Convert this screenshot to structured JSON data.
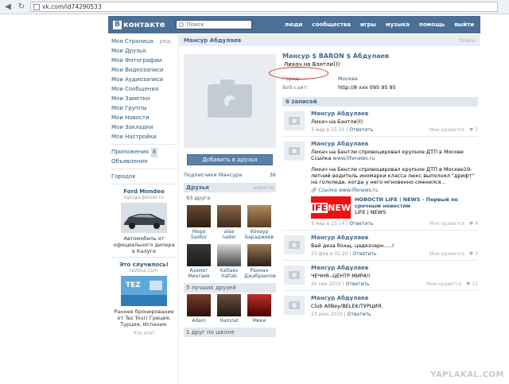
{
  "browser": {
    "url": "vk.com/id74290533"
  },
  "header": {
    "logo_text": "контакте",
    "logo_letter": "В",
    "search_placeholder": "Поиск",
    "nav": [
      "люди",
      "сообщества",
      "игры",
      "музыка",
      "помощь",
      "выйти"
    ]
  },
  "sidebar": {
    "items": [
      "Моя Страница",
      "Мои Друзья",
      "Мои Фотографии",
      "Мои Видеозаписи",
      "Мои Аудиозаписи",
      "Мои Сообщения",
      "Мои Заметки",
      "Мои Группы",
      "Мои Новости",
      "Мои Закладки",
      "Мои Настройки"
    ],
    "edit_label": "ред.",
    "apps_label": "Приложения",
    "apps_badge": "8",
    "ads_label": "Объявления",
    "city_label": "Городок",
    "ad1": {
      "title": "Ford Mondeo",
      "site": "kaluga.genser.ru",
      "text": "Автомобиль от официального дилера в Калуге"
    },
    "ad2": {
      "title": "Это случилось!",
      "site": "teztour.com",
      "text": "Раннее бронирование от Tez Tour! Греция, Турция, Испания."
    },
    "ad_link": "Что это?"
  },
  "profile": {
    "bar_name": "Мансур Абдулаев",
    "online": "Online",
    "full_name": "Мансур $ BARON $ Абдулаев",
    "status": "Лихач на Бэнтли)))",
    "city_key": "Город:",
    "city_val": "Москва",
    "web_key": "Веб-сайт:",
    "web_val": "http://8 xxx 095 95 95",
    "add_friend": "Добавить в друзья",
    "subscribers": "Подписчики Мансура",
    "subscribers_count": "36",
    "friends_title": "Друзья",
    "friends_more": "новости",
    "friends_count": "93 друга",
    "friends": [
      {
        "first": "Maga",
        "last": "Saidov"
      },
      {
        "first": "alaa",
        "last": "nader"
      },
      {
        "first": "Изнаур",
        "last": "Бараджиев"
      },
      {
        "first": "Азамат",
        "last": "Мингаев"
      },
      {
        "first": "Xattaev",
        "last": "Xattab"
      },
      {
        "first": "Рахман",
        "last": "Джабраилов"
      }
    ],
    "best_friends": "5 лучших друзей",
    "best": [
      {
        "name": "Adam"
      },
      {
        "name": "Hamzat"
      },
      {
        "name": "Мики"
      }
    ],
    "school": "1 друг по школе",
    "posts_count": "6 записей"
  },
  "posts": [
    {
      "author": "Мансур Абдулаев",
      "text": "Лихач на Бэнтли)))",
      "date": "3 мар в 15:21",
      "reply": "Ответить",
      "like": "Мне нравится",
      "count": "7"
    },
    {
      "author": "Мансур Абдулаев",
      "text1": "Лихач на Бентли спровоцировал крупное ДТП в Москве Ссылка",
      "text1_link": "www.lifenews.ru",
      "text2": "Лихач на Бентли спровоцировал крупное ДТП в Москве19-летний водитель иномарки класса люкс выполнял \"дрифт\" на гололеде, когда у него мгновенно сменился...",
      "attach_label": "Ссылка",
      "attach_link": "www.lifenews.ru",
      "thumb_l": "IFE",
      "thumb_r": "NEW",
      "news_title": "НОВОСТИ LIFE | NEWS - Первый по срочным новостям",
      "news_sub": "LIFE | NEWS",
      "date": "3 мар в 15:14",
      "reply": "Ответить",
      "like": "Мне нравится",
      "count": "4"
    },
    {
      "author": "Мансур Абдулаев",
      "text": "Вай деза бохщ, цадезчарн.....!",
      "date": "23 фев в 01:20",
      "reply": "Ответить",
      "like": "Мне нравится",
      "count": "3"
    },
    {
      "author": "Мансур Абдулаев",
      "text": "ЧЕЧНЯ--ЦЕНТР МИРА!!",
      "date": "20 сен 2010",
      "reply": "Ответить",
      "like": "Мне нравится",
      "count": "12"
    },
    {
      "author": "Мансур Абдулаев",
      "text": "Club AllBey/BELEK/ТУРЦИЯ.",
      "date": "23 июн 2010",
      "reply": "Ответить",
      "like": "",
      "count": ""
    }
  ],
  "watermark": "YAPLAKAL.COM"
}
